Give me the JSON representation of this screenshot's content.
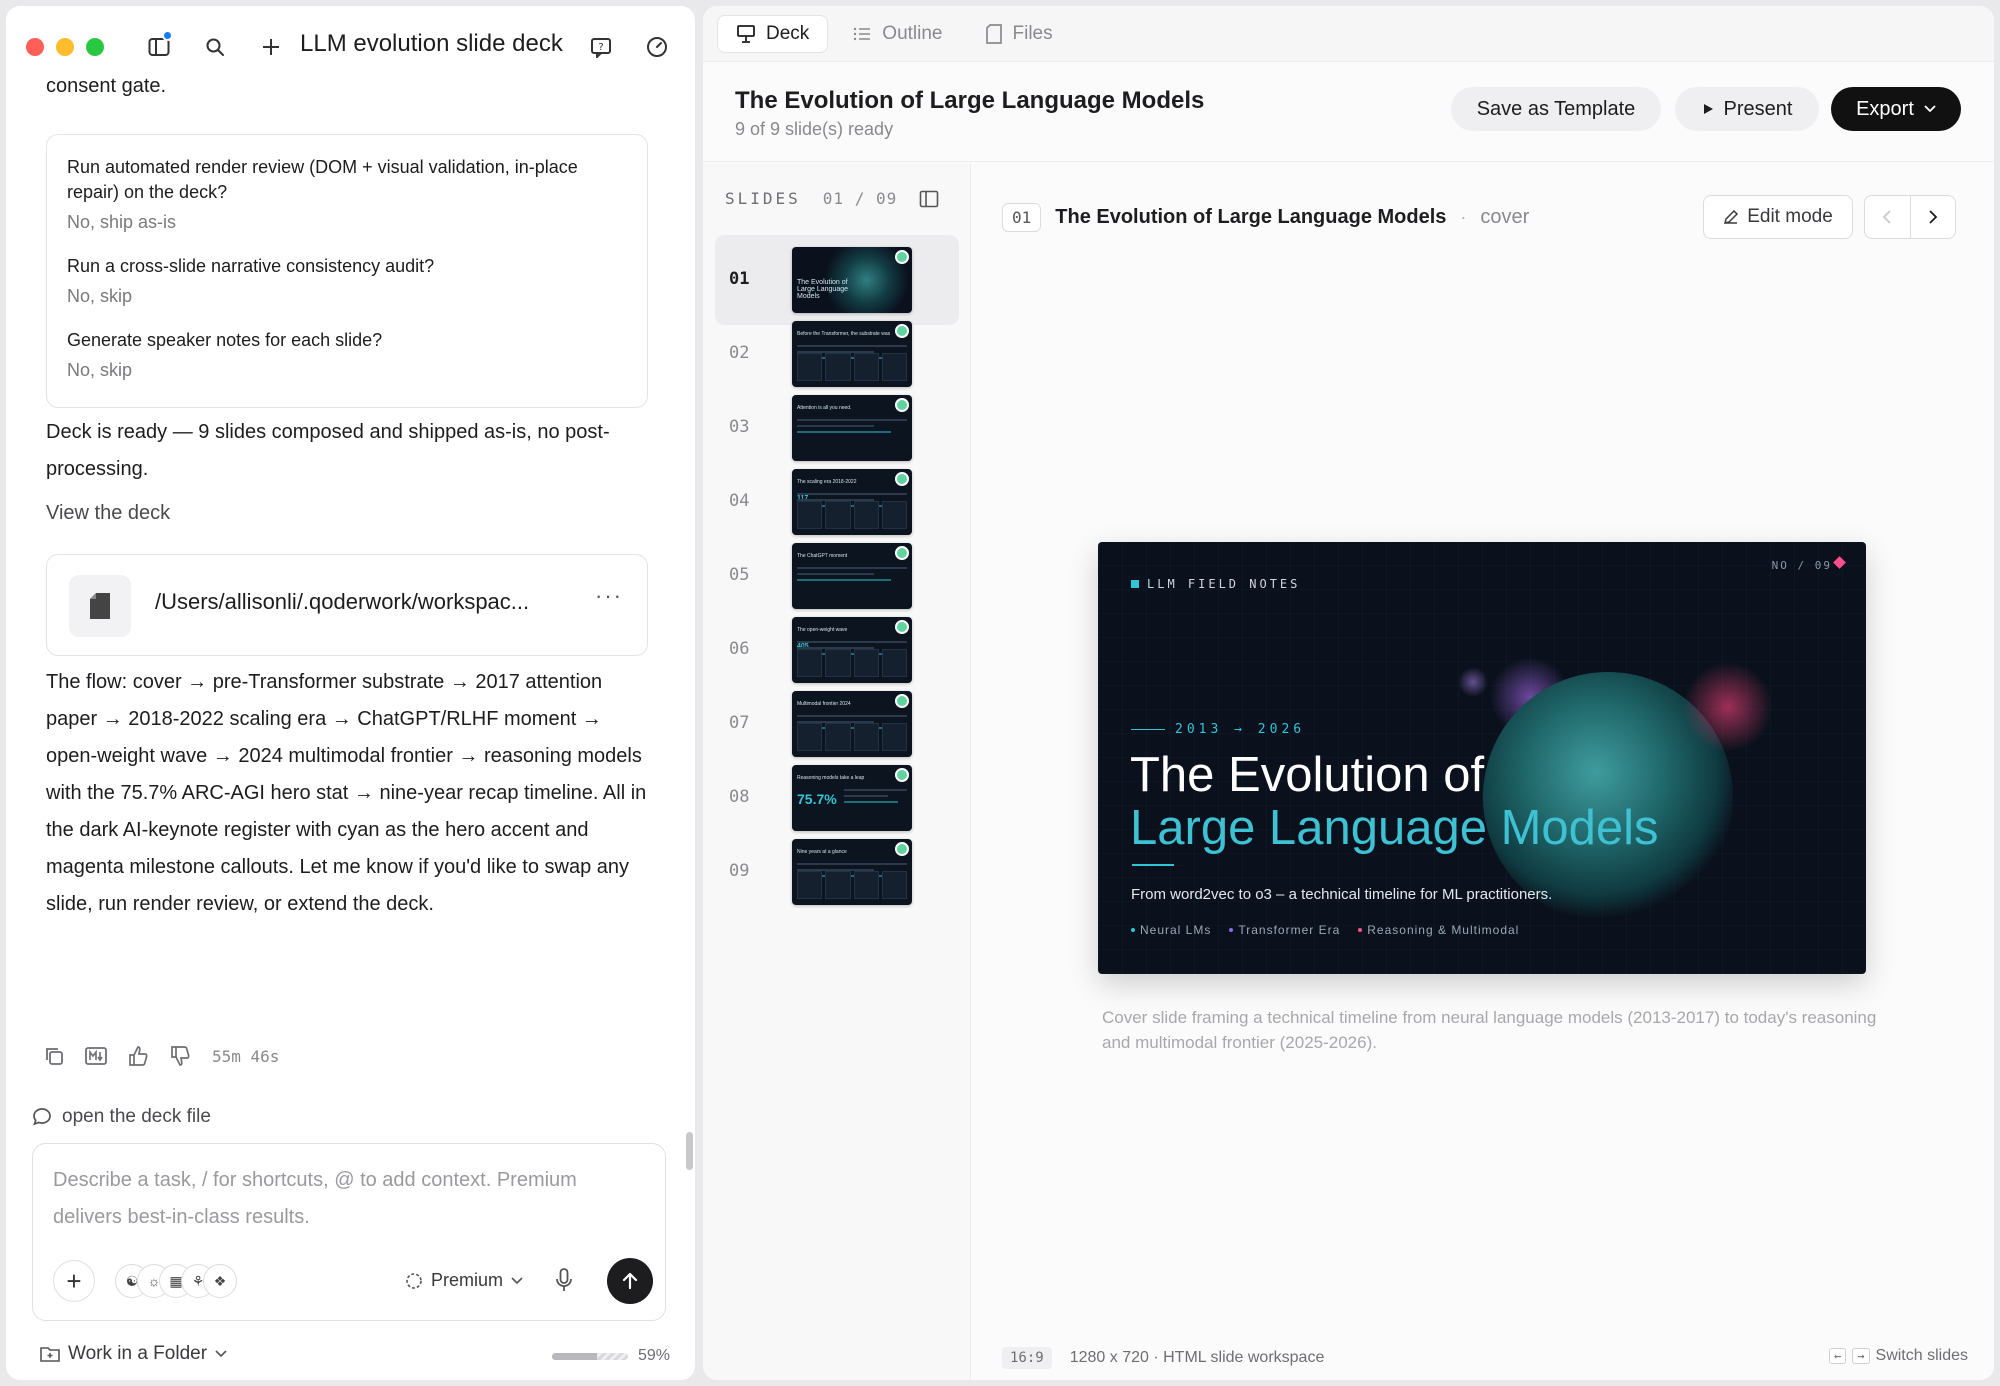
{
  "app": {
    "title": "LLM evolution slide deck"
  },
  "chat": {
    "prev_fragment": "consent gate.",
    "questions": [
      {
        "q": "Run automated render review (DOM + visual validation, in-place repair) on the deck?",
        "a": "No, ship as-is"
      },
      {
        "q": "Run a cross-slide narrative consistency audit?",
        "a": "No, skip"
      },
      {
        "q": "Generate speaker notes for each slide?",
        "a": "No, skip"
      }
    ],
    "ready_text": "Deck is ready — 9 slides composed and shipped as-is, no post-processing.",
    "view_deck": "View the deck",
    "file_path": "/Users/allisonli/.qoderwork/workspac...",
    "file_more": "···",
    "flow_text": "The flow: cover → pre-Transformer substrate → 2017 attention paper → 2018-2022 scaling era → ChatGPT/RLHF moment → open-weight wave → 2024 multimodal frontier → reasoning models with the 75.7% ARC-AGI hero stat → nine-year recap timeline. All in the dark AI-keynote register with cyan as the hero accent and magenta milestone callouts. Let me know if you'd like to swap any slide, run render review, or extend the deck.",
    "elapsed": "55m 46s",
    "suggestion": "open the deck file"
  },
  "composer": {
    "placeholder": "Describe a task, / for shortcuts, @ to add context. Premium delivers best-in-class results.",
    "model": "Premium",
    "workspace": "Work in a Folder",
    "usage_percent": 59,
    "usage_label": "59%"
  },
  "tabs": [
    {
      "label": "Deck",
      "active": true
    },
    {
      "label": "Outline",
      "active": false
    },
    {
      "label": "Files",
      "active": false
    }
  ],
  "deck": {
    "title": "The Evolution of Large Language Models",
    "status": "9 of 9 slide(s) ready",
    "save_template": "Save as Template",
    "present": "Present",
    "export": "Export"
  },
  "rail": {
    "label": "SLIDES",
    "count": "01 / 09",
    "slides": [
      {
        "num": "01",
        "kind": "cover",
        "title": "The Evolution of Large Language Models"
      },
      {
        "num": "02",
        "kind": "grid",
        "title": "Before the Transformer, the substrate was"
      },
      {
        "num": "03",
        "kind": "text",
        "title": "Attention is all you need."
      },
      {
        "num": "04",
        "kind": "stats",
        "title": "The scaling era 2018-2022",
        "big": "117"
      },
      {
        "num": "05",
        "kind": "text",
        "title": "The ChatGPT moment"
      },
      {
        "num": "06",
        "kind": "stats",
        "title": "The open-weight wave",
        "big": "405"
      },
      {
        "num": "07",
        "kind": "grid",
        "title": "Multimodal frontier 2024"
      },
      {
        "num": "08",
        "kind": "hero",
        "title": "Reasoning models take a leap",
        "big": "75.7%"
      },
      {
        "num": "09",
        "kind": "grid",
        "title": "Nine years at a glance"
      }
    ]
  },
  "stage": {
    "slide_num": "01",
    "slide_name": "The Evolution of Large Language Models",
    "slide_dot": "·",
    "slide_type": "cover",
    "edit_mode": "Edit mode",
    "caption": "Cover slide framing a technical timeline from neural language models (2013-2017) to today's reasoning and multimodal frontier (2025-2026).",
    "ratio": "16:9",
    "dims": "1280 x 720 · HTML slide workspace",
    "switch_hint": "Switch slides",
    "key_left": "←",
    "key_right": "→"
  },
  "cover_slide": {
    "brand": "LLM FIELD NOTES",
    "no": "NO / 09",
    "years": "2013 → 2026",
    "title_line1": "The Evolution of",
    "title_line2": "Large Language Models",
    "subtitle": "From word2vec to o3 – a technical timeline for ML practitioners.",
    "tags": [
      {
        "label": "Neural LMs",
        "color": "#2fc4d8"
      },
      {
        "label": "Transformer Era",
        "color": "#8a6ee0"
      },
      {
        "label": "Reasoning & Multimodal",
        "color": "#ff4d8d"
      }
    ]
  },
  "colors": {
    "accent_cyan": "#2fc4d8",
    "accent_magenta": "#ff4d8d",
    "ready_green": "#5fd3a0",
    "export_bg": "#111111"
  }
}
